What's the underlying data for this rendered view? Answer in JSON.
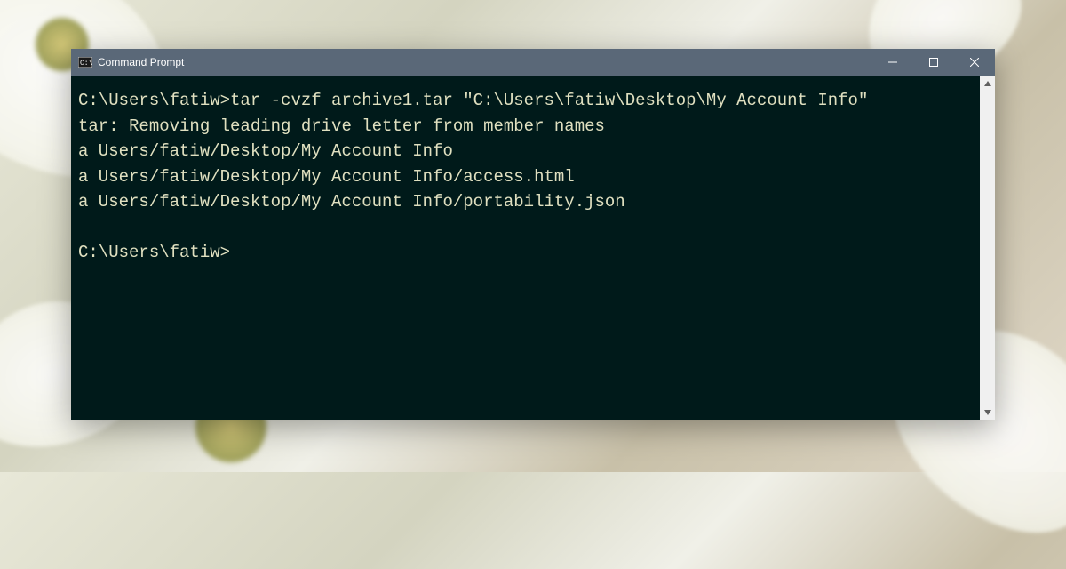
{
  "window": {
    "title": "Command Prompt"
  },
  "terminal": {
    "lines": [
      "C:\\Users\\fatiw>tar -cvzf archive1.tar \"C:\\Users\\fatiw\\Desktop\\My Account Info\"",
      "tar: Removing leading drive letter from member names",
      "a Users/fatiw/Desktop/My Account Info",
      "a Users/fatiw/Desktop/My Account Info/access.html",
      "a Users/fatiw/Desktop/My Account Info/portability.json",
      "",
      "C:\\Users\\fatiw>"
    ]
  },
  "controls": {
    "minimize": "─",
    "maximize": "☐",
    "close": "✕",
    "scroll_up": "▲",
    "scroll_down": "▼"
  }
}
